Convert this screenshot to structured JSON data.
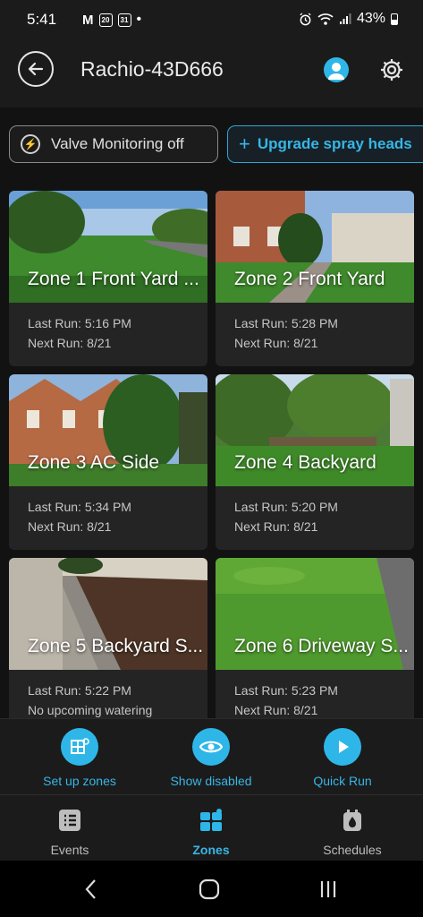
{
  "status_bar": {
    "time": "5:41",
    "mail_icon": "M",
    "cal1": "20",
    "cal2": "31",
    "dot": "•",
    "battery": "43%"
  },
  "header": {
    "title": "Rachio-43D666"
  },
  "chips": {
    "valve": "Valve Monitoring off",
    "upgrade": "Upgrade spray heads"
  },
  "zones": [
    {
      "name": "Zone 1 Front Yard ...",
      "last": "Last Run: 5:16 PM",
      "next": "Next Run: 8/21"
    },
    {
      "name": "Zone 2 Front Yard",
      "last": "Last Run: 5:28 PM",
      "next": "Next Run: 8/21"
    },
    {
      "name": "Zone 3 AC Side",
      "last": "Last Run: 5:34 PM",
      "next": "Next Run: 8/21"
    },
    {
      "name": "Zone 4 Backyard",
      "last": "Last Run: 5:20 PM",
      "next": "Next Run: 8/21"
    },
    {
      "name": "Zone 5 Backyard S...",
      "last": "Last Run: 5:22 PM",
      "next": "No upcoming watering"
    },
    {
      "name": "Zone 6 Driveway S...",
      "last": "Last Run: 5:23 PM",
      "next": "Next Run: 8/21"
    }
  ],
  "actions": {
    "setup": "Set up zones",
    "show_disabled": "Show disabled",
    "quick_run": "Quick Run"
  },
  "nav": {
    "events": "Events",
    "zones": "Zones",
    "schedules": "Schedules"
  },
  "colors": {
    "accent": "#2fb6e8",
    "background": "#121212",
    "card": "#242424"
  }
}
